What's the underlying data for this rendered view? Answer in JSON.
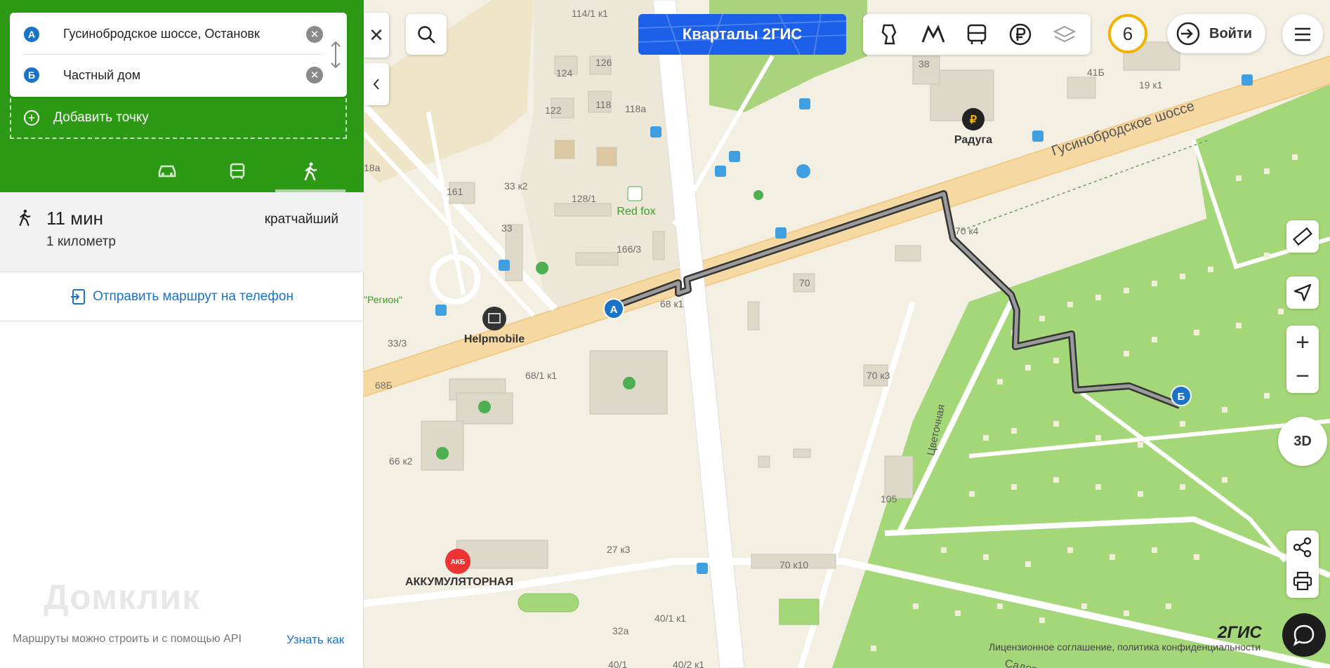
{
  "sidebar": {
    "point_a": {
      "badge": "А",
      "value": "Гусинобродское шоссе, Остановк"
    },
    "point_b": {
      "badge": "Б",
      "value": "Частный дом"
    },
    "add_point": "Добавить точку",
    "summary": {
      "time": "11 мин",
      "distance": "1 километр",
      "variant": "кратчайший"
    },
    "send_to_phone": "Отправить маршрут на телефон",
    "watermark": "Домклик",
    "api_note": "Маршруты можно строить и с помощью API",
    "api_link": "Узнать как",
    "transport_modes": [
      "car-icon",
      "bus-icon",
      "walk-icon"
    ],
    "active_mode": "walk"
  },
  "top": {
    "banner": "Кварталы 2ГИС",
    "layer_icons": [
      "attractions-icon",
      "metro-icon",
      "transport-icon",
      "ruble-icon",
      "layers-icon"
    ],
    "counter": "6",
    "login": "Войти"
  },
  "map": {
    "labels": {
      "b114": "114/1 к1",
      "b124": "124",
      "b126": "126",
      "b122": "122",
      "b118": "118",
      "b118a": "118а",
      "b161": "161",
      "b33k2": "33 к2",
      "b128": "128/1",
      "b33": "33",
      "b166": "166/3",
      "b18a": "18а",
      "b38": "38",
      "b41b": "41Б",
      "b19": "19 к1",
      "b70": "70",
      "b70k3": "70 к3",
      "b70k4": "70 к4",
      "b68k1": "68 к1",
      "b68_1": "68/1 к1",
      "b68b": "68Б",
      "b33_3": "33/3",
      "b66": "66 к2",
      "b27": "27 к3",
      "b70k10": "70 к10",
      "b105": "105",
      "b40": "40/1 к1",
      "b32a": "32а",
      "b40b": "40/1",
      "b40c": "40/2 к1",
      "region": "\"Регион\"",
      "street1": "Гусинобродское шоссе",
      "street2": "Цветочная",
      "street3": "Садовая"
    },
    "pois": {
      "raduga": "Радуга",
      "redfox": "Red fox",
      "helpmobile": "Helpmobile",
      "akb": "АККУМУЛЯТОРНАЯ"
    },
    "route_color": "#555555",
    "logo": "2ГИС",
    "license": "Лицензионное соглашение, политика конфиденциальности"
  }
}
